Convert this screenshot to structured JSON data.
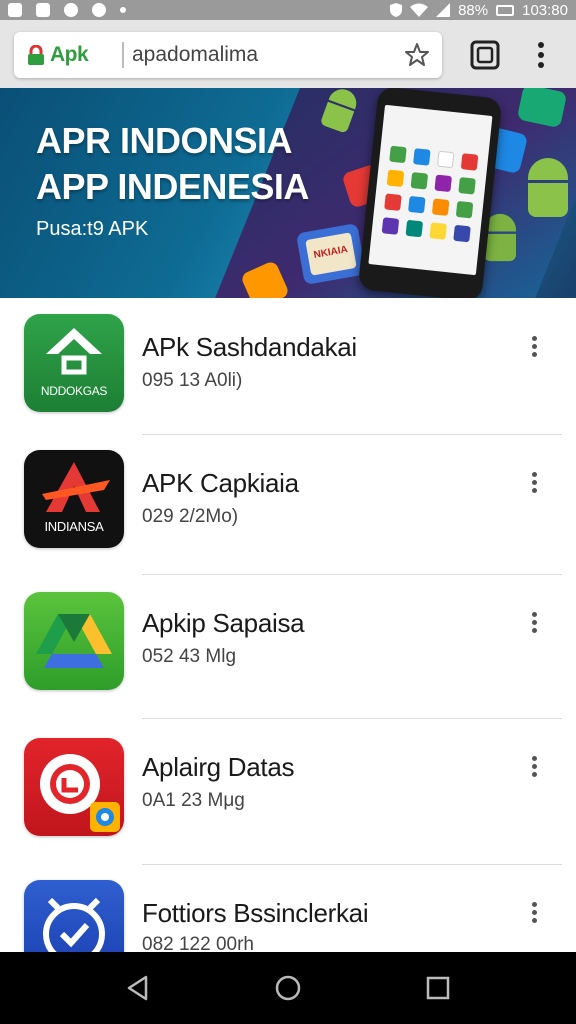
{
  "status_bar": {
    "battery": "88%",
    "time": "103:80"
  },
  "browser": {
    "site_name": "Apk",
    "url": "apadomalima",
    "icons": [
      "lock-icon",
      "star-icon",
      "tabs-icon",
      "menu-icon"
    ]
  },
  "banner": {
    "title_line1": "APR INDONSIA",
    "title_line2": "APP INDENESIA",
    "subtitle": "Pusa:t9 APK",
    "sticker_text": "ΝΚΙΑΙΑ"
  },
  "apps": [
    {
      "name": "APk Sashdandakai",
      "meta": "095 13 A0li)",
      "icon_label": "NDDOKGAS",
      "icon": "home-arrow-icon",
      "colors": [
        "#2fa34a",
        "#1d7f34"
      ]
    },
    {
      "name": "APK Capkiaia",
      "meta": "029 2/2Mo)",
      "icon_label": "INDIANSA",
      "icon": "red-a-logo-icon",
      "colors": [
        "#111111",
        "#2a2a2a"
      ]
    },
    {
      "name": "Apkip Sapaisa",
      "meta": "052 43 Mlg",
      "icon_label": "",
      "icon": "drive-triangle-icon",
      "colors": [
        "#5bc43d",
        "#2e9e2a"
      ]
    },
    {
      "name": "Aplairg Datas",
      "meta": "0A1 23 Mμg",
      "icon_label": "",
      "icon": "gear-badge-icon",
      "colors": [
        "#e2242b",
        "#c0151c"
      ]
    },
    {
      "name": "Fottiors Bssinclerkai",
      "meta": "082 122 00rh",
      "icon_label": "",
      "icon": "clock-icon",
      "colors": [
        "#2f5fd0",
        "#1a3fb0"
      ]
    }
  ],
  "nav": {
    "icons": [
      "back-icon",
      "home-icon",
      "recent-apps-icon"
    ]
  }
}
